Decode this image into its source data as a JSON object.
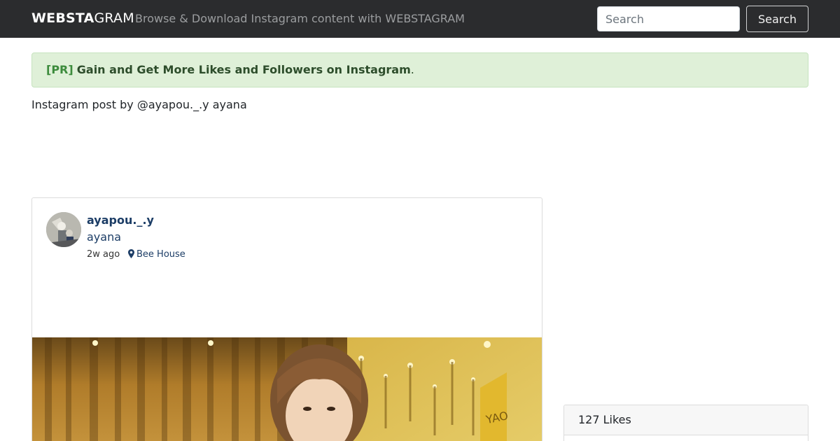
{
  "navbar": {
    "brand_bold": "WEBSTA",
    "brand_light": "GRAM",
    "tagline": "Browse & Download Instagram content with WEBSTAGRAM",
    "search_placeholder": "Search",
    "search_button": "Search"
  },
  "pr_alert": {
    "tag": "[PR]",
    "link_text": "Gain and Get More Likes and Followers on Instagram",
    "suffix": "."
  },
  "page": {
    "post_title": "Instagram post by @ayapou._.y ayana"
  },
  "post": {
    "username": "ayapou._.y",
    "fullname": "ayana",
    "time_ago": "2w ago",
    "location": "Bee House",
    "avatar_icon": "avatar-photo",
    "location_icon": "map-marker-icon"
  },
  "likes": {
    "label": "127 Likes"
  },
  "colors": {
    "navbar_bg": "#2b2c2e",
    "link": "#1c3d66",
    "pr_bg": "#dff0d8",
    "pr_tag": "#3c8b3c"
  }
}
